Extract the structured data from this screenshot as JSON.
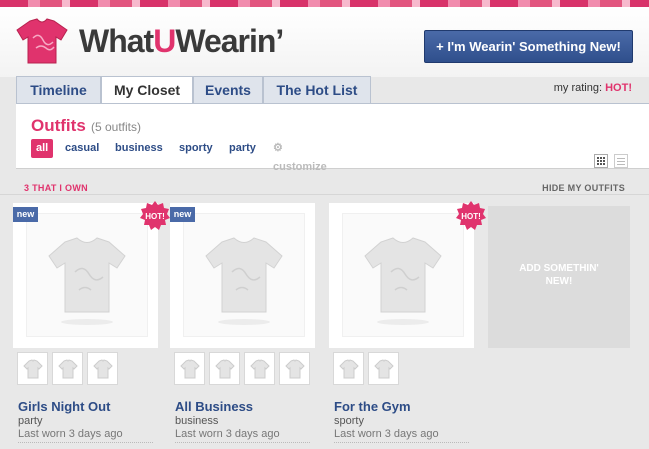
{
  "brand": {
    "name_prefix": "What",
    "name_accent": "U",
    "name_suffix": "Wearin’",
    "accent_color": "#e0336d"
  },
  "header": {
    "new_button": "+ I'm Wearin' Something New!"
  },
  "tabs": [
    {
      "label": "Timeline"
    },
    {
      "label": "My Closet",
      "active": true
    },
    {
      "label": "Events"
    },
    {
      "label": "The Hot List"
    }
  ],
  "rating": {
    "label": "my rating:",
    "value": "HOT!"
  },
  "outfits": {
    "title": "Outfits",
    "count": "(5 outfits)"
  },
  "filters": [
    {
      "label": "all",
      "active": true
    },
    {
      "label": "casual"
    },
    {
      "label": "business"
    },
    {
      "label": "sporty"
    },
    {
      "label": "party"
    }
  ],
  "customize": "customize",
  "section": {
    "heading": "3 THAT I OWN",
    "hide_link": "HIDE MY OUTFITS"
  },
  "cards": [
    {
      "name": "Girls Night Out",
      "tag": "party",
      "worn": "Last worn 3 days ago",
      "new_badge": "new",
      "hot_badge": "HOT!"
    },
    {
      "name": "All Business",
      "tag": "business",
      "worn": "Last worn 3 days ago",
      "new_badge": "new"
    },
    {
      "name": "For the Gym",
      "tag": "sporty",
      "worn": "Last worn 3 days ago",
      "hot_badge": "HOT!"
    }
  ],
  "add_outfit": {
    "line1": "ADD SOMETHIN'",
    "line2": "NEW!"
  },
  "icons": {
    "logo": "pink-tshirt-icon",
    "hot": "hot-starburst-badge",
    "grid_view": "grid-view-icon",
    "list_view": "list-view-icon",
    "customize": "gear-icon"
  }
}
